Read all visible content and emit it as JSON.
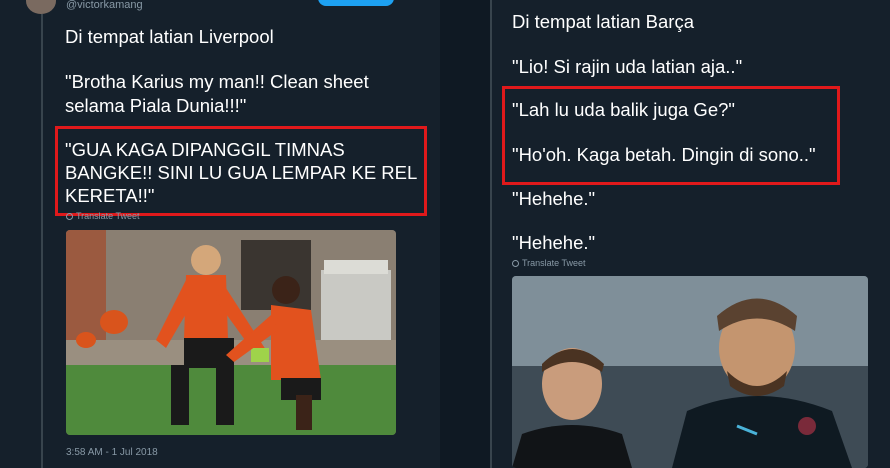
{
  "left_tweet": {
    "handle": "@victorkamang",
    "lines": [
      "Di tempat latian Liverpool",
      "\"Brotha Karius my man!! Clean sheet",
      "selama Piala Dunia!!!\""
    ],
    "highlight_lines": [
      "\"GUA KAGA DIPANGGIL TIMNAS",
      "BANGKE!! SINI LU GUA LEMPAR KE REL",
      "KERETA!!\""
    ],
    "translate_label": "Translate Tweet",
    "timestamp": "3:58 AM - 1 Jul 2018"
  },
  "right_tweet": {
    "lines": [
      "Di tempat latian Barça",
      "\"Lio! Si rajin uda latian aja..\""
    ],
    "highlight_lines": [
      "\"Lah lu uda balik juga Ge?\"",
      "\"Ho'oh. Kaga betah. Dingin di sono..\""
    ],
    "after_lines": [
      "\"Hehehe.\"",
      "\"Hehehe.\""
    ],
    "translate_label": "Translate Tweet"
  },
  "colors": {
    "background": "#15202b",
    "highlight_border": "#e0191b",
    "muted_text": "#8899a6",
    "accent": "#1da1f2"
  }
}
